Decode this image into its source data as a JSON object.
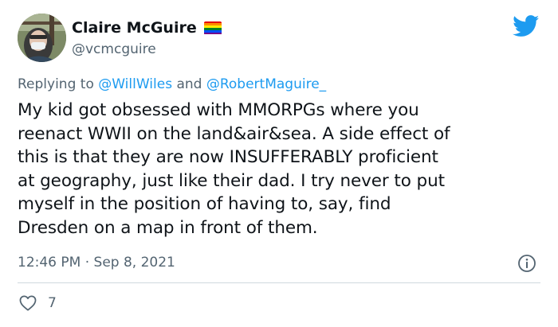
{
  "author": {
    "name": "Claire McGuire",
    "handle": "@vcmcguire",
    "flag_colors": [
      "#e40303",
      "#ff8c00",
      "#ffed00",
      "#008026",
      "#004dff",
      "#750787"
    ]
  },
  "brand": {
    "icon": "twitter-bird-icon",
    "color": "#1d9bf0"
  },
  "reply": {
    "prefix": "Replying to ",
    "mention1": "@WillWiles",
    "joiner": " and ",
    "mention2": "@RobertMaguire_"
  },
  "tweet": {
    "lines": [
      "My kid got obsessed with MMORPGs where you",
      "reenact WWII on the land&air&sea. A side effect of",
      "this is that they are now INSUFFERABLY proficient",
      "at geography, just like their dad. I try never to put",
      "myself in the position of having to, say, find",
      "Dresden on a map in front of them."
    ]
  },
  "meta": {
    "timestamp": "12:46 PM · Sep 8, 2021",
    "info_icon": "info-icon"
  },
  "actions": {
    "like_icon": "heart-icon",
    "like_count": "7"
  }
}
